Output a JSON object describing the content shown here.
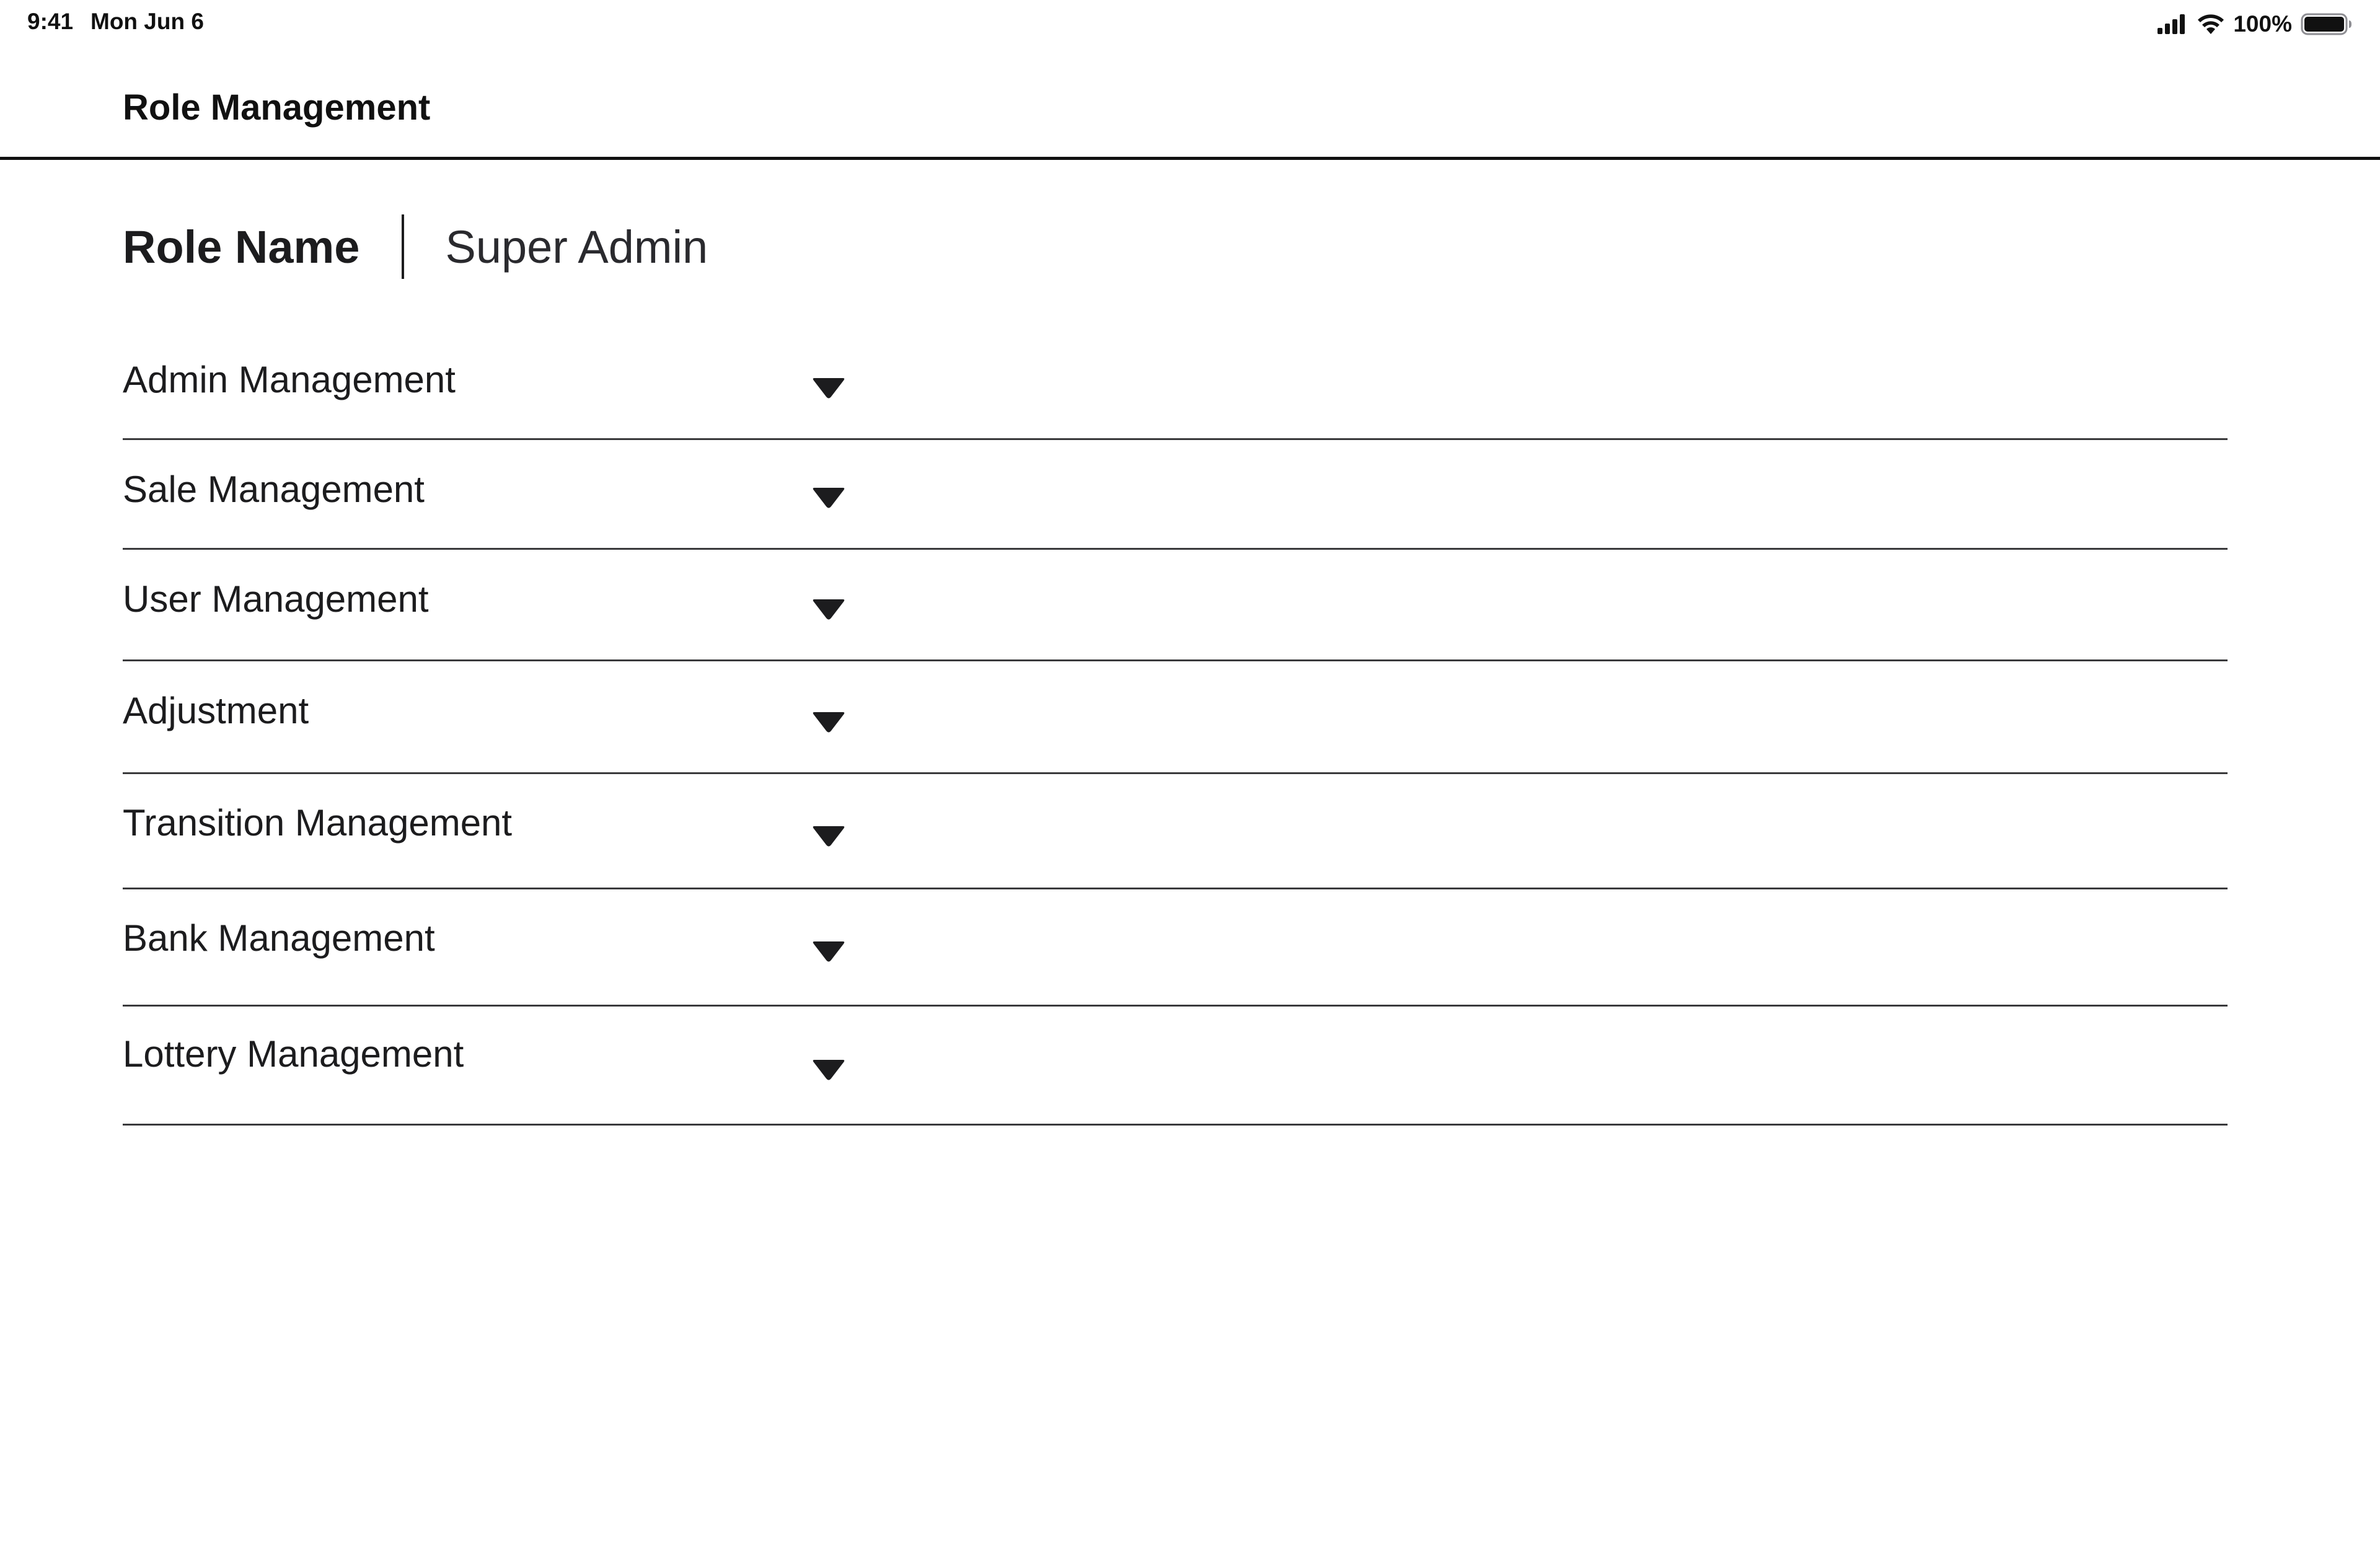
{
  "status_bar": {
    "time": "9:41",
    "date": "Mon Jun 6",
    "battery_percent": "100%",
    "icons": [
      "signal-icon",
      "wifi-icon",
      "battery-icon"
    ]
  },
  "header": {
    "title": "Role Management"
  },
  "role": {
    "label": "Role Name",
    "value": "Super Admin"
  },
  "permissions": {
    "items": [
      {
        "label": "Admin Management",
        "icon": "chevron-down-icon"
      },
      {
        "label": "Sale Management",
        "icon": "chevron-down-icon"
      },
      {
        "label": "User Management",
        "icon": "chevron-down-icon"
      },
      {
        "label": "Adjustment",
        "icon": "chevron-down-icon"
      },
      {
        "label": "Transition Management",
        "icon": "chevron-down-icon"
      },
      {
        "label": "Bank Management",
        "icon": "chevron-down-icon"
      },
      {
        "label": "Lottery Management",
        "icon": "chevron-down-icon"
      }
    ]
  },
  "colors": {
    "text": "#1c1c1e",
    "divider": "#3a3a3c",
    "background": "#ffffff"
  }
}
